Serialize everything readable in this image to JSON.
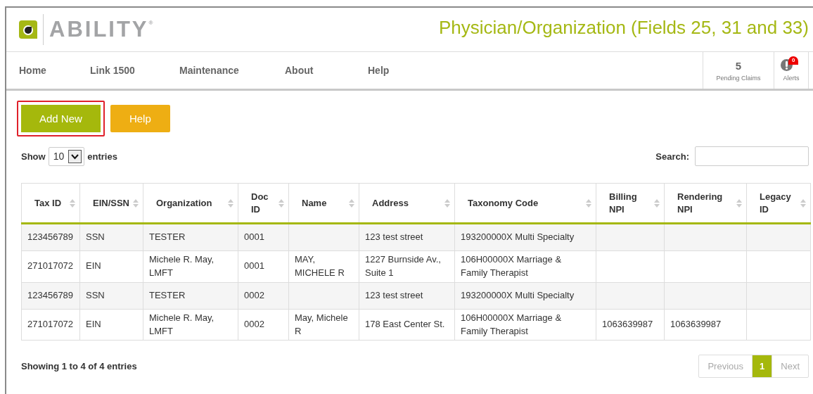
{
  "logo": {
    "text": "ABILITY",
    "mark": "®"
  },
  "page_title": "Physician/Organization (Fields 25, 31 and 33)",
  "nav": {
    "items": [
      "Home",
      "Link 1500",
      "Maintenance",
      "About",
      "Help"
    ],
    "pending_claims": {
      "count": "5",
      "label": "Pending Claims"
    },
    "alerts": {
      "count": "0",
      "label": "Alerts"
    }
  },
  "buttons": [
    {
      "label": "Add New",
      "kind": "primary",
      "highlighted": true
    },
    {
      "label": "Help",
      "kind": "secondary",
      "highlighted": false
    }
  ],
  "length_menu": {
    "before": "Show",
    "value": "10",
    "after": "entries"
  },
  "search": {
    "label": "Search:"
  },
  "table": {
    "columns": [
      "Tax ID",
      "EIN/SSN",
      "Organization",
      "Doc ID",
      "Name",
      "Address",
      "Taxonomy Code",
      "Billing NPI",
      "Rendering NPI",
      "Legacy ID"
    ],
    "rows": [
      [
        "123456789",
        "SSN",
        "TESTER",
        "0001",
        "",
        "123 test street",
        "193200000X Multi Specialty",
        "",
        "",
        ""
      ],
      [
        "271017072",
        "EIN",
        "Michele R. May, LMFT",
        "0001",
        "MAY, MICHELE R",
        "1227 Burnside Av., Suite 1",
        "106H00000X Marriage & Family Therapist",
        "",
        "",
        ""
      ],
      [
        "123456789",
        "SSN",
        "TESTER",
        "0002",
        "",
        "123 test street",
        "193200000X Multi Specialty",
        "",
        "",
        ""
      ],
      [
        "271017072",
        "EIN",
        "Michele R. May, LMFT",
        "0002",
        "May, Michele R",
        "178 East Center St.",
        "106H00000X Marriage & Family Therapist",
        "1063639987",
        "1063639987",
        ""
      ]
    ]
  },
  "info": "Showing 1 to 4 of 4 entries",
  "pagination": [
    {
      "label": "Previous",
      "disabled": true,
      "selected": false
    },
    {
      "label": "1",
      "disabled": false,
      "selected": true
    },
    {
      "label": "Next",
      "disabled": true,
      "selected": false
    }
  ]
}
